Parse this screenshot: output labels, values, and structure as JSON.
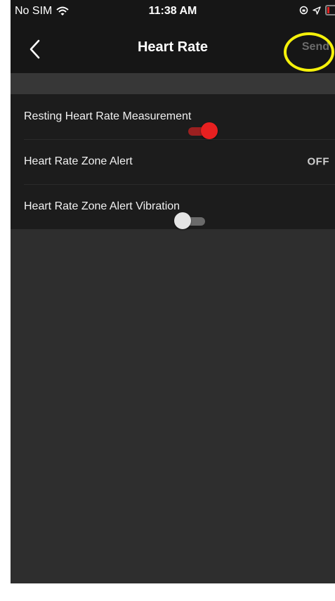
{
  "status_bar": {
    "carrier": "No SIM",
    "time": "11:38 AM",
    "icons": [
      "wifi-icon",
      "orientation-lock-icon",
      "location-icon",
      "battery-icon"
    ]
  },
  "nav": {
    "title": "Heart Rate",
    "back_icon": "chevron-left-icon",
    "send_label": "Send"
  },
  "settings": [
    {
      "label": "Resting Heart Rate Measurement",
      "control": "toggle",
      "state": "on"
    },
    {
      "label": "Heart Rate Zone Alert",
      "control": "value",
      "value": "OFF"
    },
    {
      "label": "Heart Rate Zone Alert Vibration",
      "control": "toggle",
      "state": "off"
    }
  ],
  "colors": {
    "accent_on": "#e82020",
    "highlight": "#f5f10a",
    "background": "#2e2e2e",
    "bar": "#161616"
  }
}
